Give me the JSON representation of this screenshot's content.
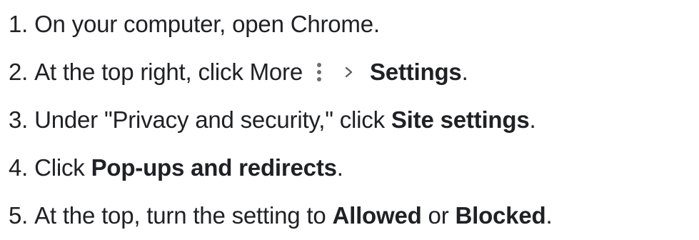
{
  "steps": [
    {
      "number": "1.",
      "text_before": "On your computer, open Chrome."
    },
    {
      "number": "2.",
      "text_before": "At the top right, click More",
      "icon_more": "more-vert-icon",
      "icon_arrow": "chevron-right-icon",
      "bold_1": "Settings",
      "text_after": "."
    },
    {
      "number": "3.",
      "text_before": "Under \"Privacy and security,\" click",
      "bold_1": "Site settings",
      "text_after": "."
    },
    {
      "number": "4.",
      "text_before": "Click",
      "bold_1": "Pop-ups and redirects",
      "text_after": "."
    },
    {
      "number": "5.",
      "text_before": "At the top, turn the setting to",
      "bold_1": "Allowed",
      "text_middle": "or",
      "bold_2": "Blocked",
      "text_after": "."
    }
  ]
}
